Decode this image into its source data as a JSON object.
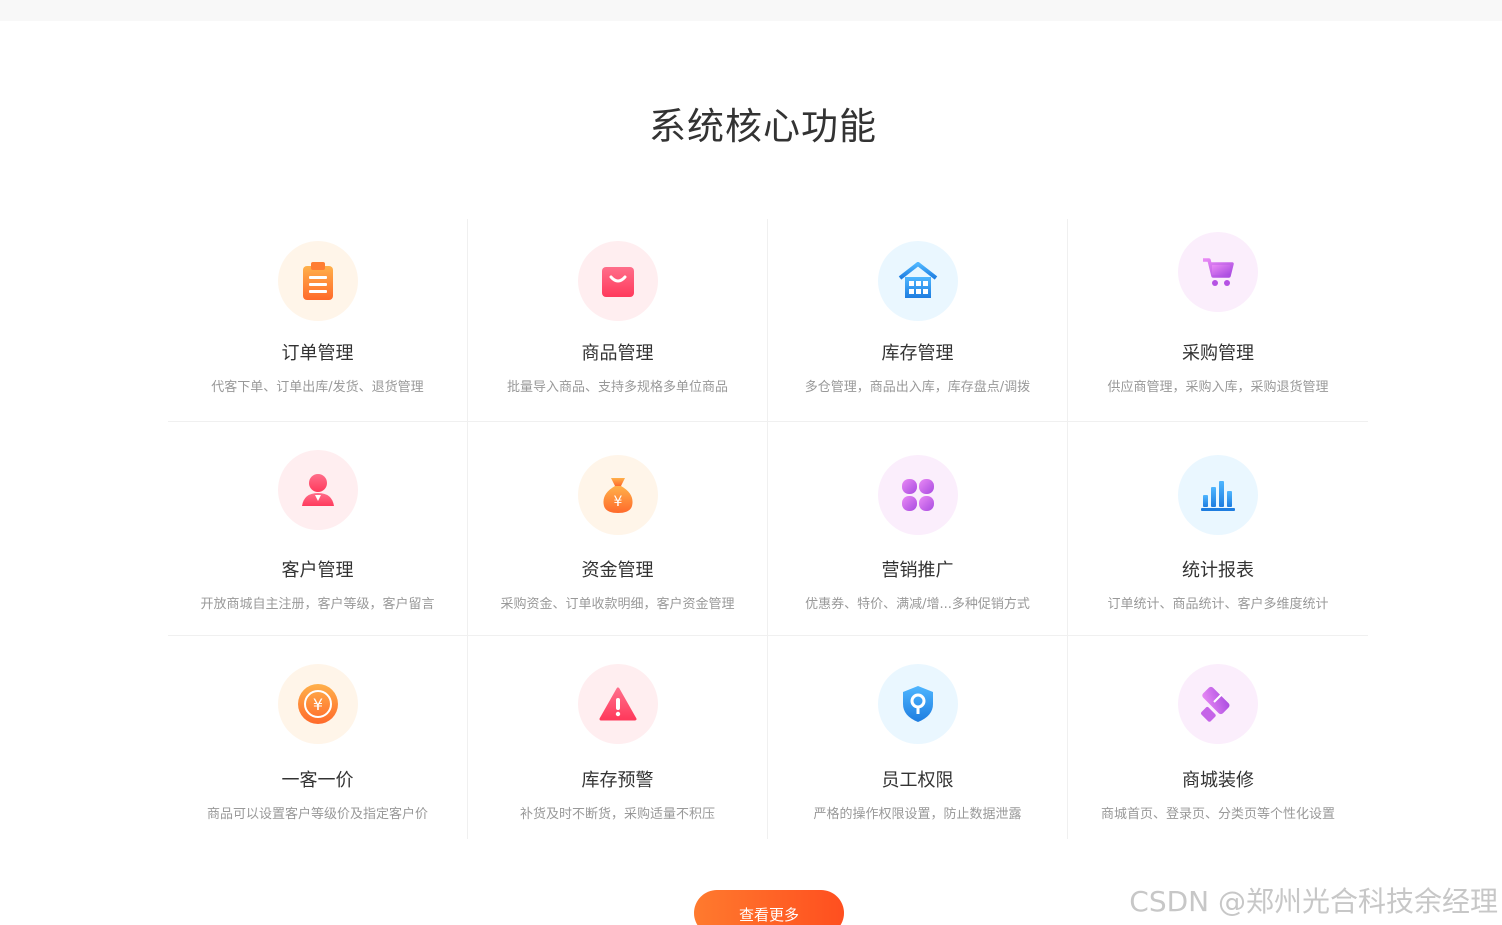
{
  "section": {
    "title": "系统核心功能"
  },
  "features": [
    {
      "title": "订单管理",
      "desc": "代客下单、订单出库/发货、退货管理",
      "icon": "clipboard-icon",
      "bg": "#fff5e9",
      "color": "#ff8a3d"
    },
    {
      "title": "商品管理",
      "desc": "批量导入商品、支持多规格多单位商品",
      "icon": "shopping-bag-icon",
      "bg": "#ffeef0",
      "color": "#ff4d6a"
    },
    {
      "title": "库存管理",
      "desc": "多仓管理，商品出入库，库存盘点/调拨",
      "icon": "warehouse-icon",
      "bg": "#eaf7ff",
      "color": "#2b8ff0"
    },
    {
      "title": "采购管理",
      "desc": "供应商管理，采购入库，采购退货管理",
      "icon": "cart-icon",
      "bg": "#fbeefc",
      "color": "#c564e8"
    },
    {
      "title": "客户管理",
      "desc": "开放商城自主注册，客户等级，客户留言",
      "icon": "user-icon",
      "bg": "#ffeef0",
      "color": "#ff4d6a"
    },
    {
      "title": "资金管理",
      "desc": "采购资金、订单收款明细，客户资金管理",
      "icon": "money-bag-icon",
      "bg": "#fff5e9",
      "color": "#ff8a3d"
    },
    {
      "title": "营销推广",
      "desc": "优惠券、特价、满减/增...多种促销方式",
      "icon": "clover-icon",
      "bg": "#fbeefc",
      "color": "#c564e8"
    },
    {
      "title": "统计报表",
      "desc": "订单统计、商品统计、客户多维度统计",
      "icon": "bar-chart-icon",
      "bg": "#eaf7ff",
      "color": "#2b8ff0"
    },
    {
      "title": "一客一价",
      "desc": "商品可以设置客户等级价及指定客户价",
      "icon": "yen-coin-icon",
      "bg": "#fff5e9",
      "color": "#ff8a3d"
    },
    {
      "title": "库存预警",
      "desc": "补货及时不断货，采购适量不积压",
      "icon": "warning-icon",
      "bg": "#ffeef0",
      "color": "#ff4d6a"
    },
    {
      "title": "员工权限",
      "desc": "严格的操作权限设置，防止数据泄露",
      "icon": "shield-key-icon",
      "bg": "#eaf7ff",
      "color": "#2b8ff0"
    },
    {
      "title": "商城装修",
      "desc": "商城首页、登录页、分类页等个性化设置",
      "icon": "paint-roller-icon",
      "bg": "#fbeefc",
      "color": "#c564e8"
    }
  ],
  "more_button": {
    "label": "查看更多"
  },
  "watermark": "CSDN @郑州光合科技余经理"
}
